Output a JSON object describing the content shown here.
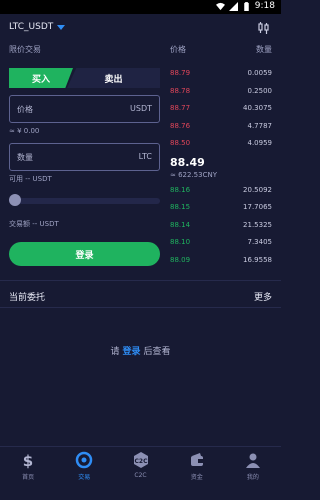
{
  "status_bar": {
    "time": "9:18"
  },
  "header": {
    "pair": "LTC_USDT"
  },
  "trade": {
    "section_label": "限价交易",
    "tab_buy": "买入",
    "tab_sell": "卖出",
    "price_placeholder": "价格",
    "price_unit": "USDT",
    "approx": "≈ ¥ 0.00",
    "amount_placeholder": "数量",
    "amount_unit": "LTC",
    "available": "可用 -- USDT",
    "volume": "交易额  -- USDT",
    "slider_level": 0,
    "login_button": "登录"
  },
  "orderbook": {
    "price_header": "价格",
    "qty_header": "数量",
    "asks": [
      {
        "price": "88.79",
        "qty": "0.0059"
      },
      {
        "price": "88.78",
        "qty": "0.2500"
      },
      {
        "price": "88.77",
        "qty": "40.3075"
      },
      {
        "price": "88.76",
        "qty": "4.7787"
      },
      {
        "price": "88.50",
        "qty": "4.0959"
      }
    ],
    "last_price": "88.49",
    "last_cny": "≈ 622.53CNY",
    "bids": [
      {
        "price": "88.16",
        "qty": "20.5092"
      },
      {
        "price": "88.15",
        "qty": "17.7065"
      },
      {
        "price": "88.14",
        "qty": "21.5325"
      },
      {
        "price": "88.10",
        "qty": "7.3405"
      },
      {
        "price": "88.09",
        "qty": "16.9558"
      }
    ],
    "colors": {
      "ask": "#e2465a",
      "bid": "#1fb35f"
    }
  },
  "orders": {
    "title": "当前委托",
    "more": "更多",
    "empty_prefix": "请",
    "empty_link": "登录",
    "empty_suffix": "后查看"
  },
  "nav": [
    {
      "label": "首页",
      "icon": "dollar-icon"
    },
    {
      "label": "交易",
      "icon": "trade-icon"
    },
    {
      "label": "C2C",
      "icon": "c2c-icon"
    },
    {
      "label": "资金",
      "icon": "wallet-icon"
    },
    {
      "label": "我的",
      "icon": "user-icon"
    }
  ],
  "accent": "#2f8df5"
}
